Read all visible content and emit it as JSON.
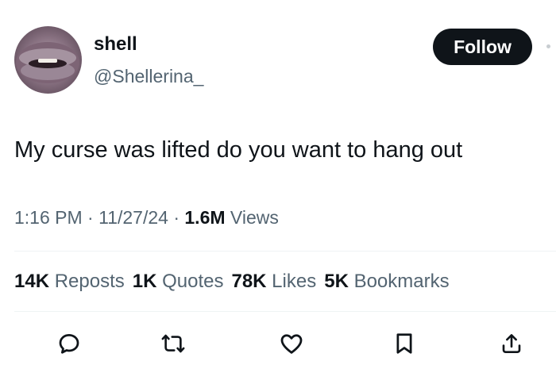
{
  "user": {
    "name": "shell",
    "handle": "@Shellerina_",
    "follow_label": "Follow"
  },
  "tweet": {
    "text": "My curse was lifted do you want to hang out"
  },
  "meta": {
    "time": "1:16 PM",
    "sep1": " · ",
    "date": "11/27/24",
    "sep2": " · ",
    "views_count": "1.6M",
    "views_label": " Views"
  },
  "stats": {
    "reposts_count": "14K",
    "reposts_label": " Reposts",
    "quotes_count": "1K",
    "quotes_label": " Quotes",
    "likes_count": "78K",
    "likes_label": " Likes",
    "bookmarks_count": "5K",
    "bookmarks_label": " Bookmarks"
  },
  "actions": [
    "reply-icon",
    "repost-icon",
    "like-icon",
    "bookmark-icon",
    "share-icon"
  ],
  "colors": {
    "text": "#0f1419",
    "secondary": "#536471",
    "button_bg": "#0f1419",
    "divider": "#eff3f4"
  }
}
